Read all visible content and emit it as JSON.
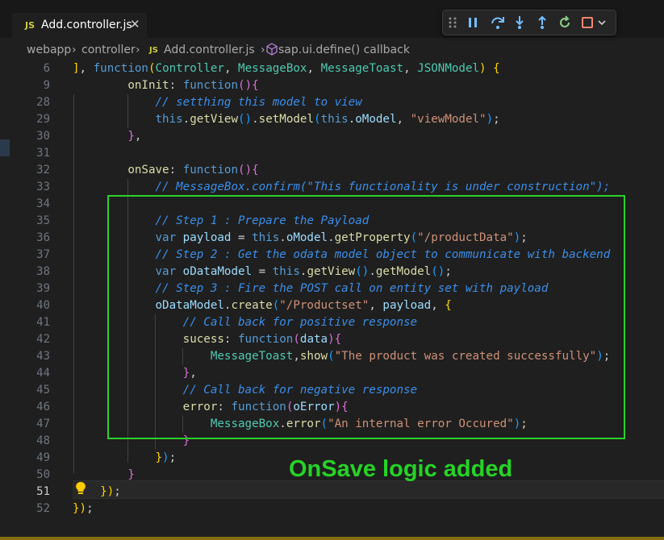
{
  "tab": {
    "badge": "JS",
    "title": "Add.controller.js",
    "close_glyph": "✕"
  },
  "breadcrumb": [
    "webapp",
    "controller",
    "Add.controller.js",
    "sap.ui.define() callback"
  ],
  "breadcrumb_js_badge": "JS",
  "debug_toolbar": [
    "drag-handle-icon",
    "pause-icon",
    "step-over-icon",
    "step-into-icon",
    "step-out-icon",
    "restart-icon",
    "stop-icon",
    "chevron-down-icon"
  ],
  "lines": [
    {
      "n": "6",
      "html": "<span class=\"b1\">]</span>, <span class=\"kw\">function</span><span class=\"b1\">(</span><span class=\"cls\">Controller</span>, <span class=\"cls\">MessageBox</span>, <span class=\"cls\">MessageToast</span>, <span class=\"cls\">JSONModel</span><span class=\"b1\">)</span> <span class=\"b1\">{</span>"
    },
    {
      "n": "9",
      "html": "        <span class=\"fn\">onInit</span>: <span class=\"kw\">function</span><span class=\"b2\">()</span><span class=\"b2\">{</span>"
    },
    {
      "n": "28",
      "html": "            <span class=\"cm\">// setthing this model to view</span>"
    },
    {
      "n": "29",
      "html": "            <span class=\"kw\">this</span>.<span class=\"fn\">getView</span><span class=\"b3\">()</span>.<span class=\"fn\">setModel</span><span class=\"b3\">(</span><span class=\"kw\">this</span>.<span class=\"prop\">oModel</span>, <span class=\"str\">\"viewModel\"</span><span class=\"b3\">)</span>;"
    },
    {
      "n": "30",
      "html": "        <span class=\"b2\">}</span>,"
    },
    {
      "n": "31",
      "html": ""
    },
    {
      "n": "32",
      "html": "        <span class=\"fn\">onSave</span>: <span class=\"kw\">function</span><span class=\"b2\">()</span><span class=\"b2\">{</span>"
    },
    {
      "n": "33",
      "html": "            <span class=\"cm\">// MessageBox.confirm(\"This functionality is under construction\");</span>"
    },
    {
      "n": "34",
      "html": ""
    },
    {
      "n": "35",
      "html": "            <span class=\"cm\">// Step 1 : Prepare the Payload</span>"
    },
    {
      "n": "36",
      "html": "            <span class=\"kw\">var</span> <span class=\"var\">payload</span> = <span class=\"kw\">this</span>.<span class=\"prop\">oModel</span>.<span class=\"fn\">getProperty</span><span class=\"b3\">(</span><span class=\"str\">\"/productData\"</span><span class=\"b3\">)</span>;"
    },
    {
      "n": "37",
      "html": "            <span class=\"cm\">// Step 2 : Get the odata model object to communicate with backend</span>"
    },
    {
      "n": "38",
      "html": "            <span class=\"kw\">var</span> <span class=\"var\">oDataModel</span> = <span class=\"kw\">this</span>.<span class=\"fn\">getView</span><span class=\"b3\">()</span>.<span class=\"fn\">getModel</span><span class=\"b3\">()</span>;"
    },
    {
      "n": "39",
      "html": "            <span class=\"cm\">// Step 3 : Fire the POST call on entity set with payload</span>"
    },
    {
      "n": "40",
      "html": "            <span class=\"var\">oDataModel</span>.<span class=\"fn\">create</span><span class=\"b3\">(</span><span class=\"str\">\"/Productset\"</span>, <span class=\"var\">payload</span>, <span class=\"b1\">{</span>"
    },
    {
      "n": "41",
      "html": "                <span class=\"cm\">// Call back for positive response</span>"
    },
    {
      "n": "42",
      "html": "                <span class=\"fn\">sucess</span>: <span class=\"kw\">function</span><span class=\"b2\">(</span><span class=\"var\">data</span><span class=\"b2\">)</span><span class=\"b2\">{</span>"
    },
    {
      "n": "43",
      "html": "                    <span class=\"cls\">MessageToast</span>,<span class=\"fn\">show</span><span class=\"b3\">(</span><span class=\"str\">\"The product was created successfully\"</span><span class=\"b3\">)</span>;"
    },
    {
      "n": "44",
      "html": "                <span class=\"b2\">}</span>,"
    },
    {
      "n": "45",
      "html": "                <span class=\"cm\">// Call back for negative response</span>"
    },
    {
      "n": "46",
      "html": "                <span class=\"fn\">error</span>: <span class=\"kw\">function</span><span class=\"b2\">(</span><span class=\"var\">oError</span><span class=\"b2\">)</span><span class=\"b2\">{</span>"
    },
    {
      "n": "47",
      "html": "                    <span class=\"cls\">MessageBox</span>.<span class=\"fn\">error</span><span class=\"b3\">(</span><span class=\"str\">\"An internal error Occured\"</span><span class=\"b3\">)</span>;"
    },
    {
      "n": "48",
      "html": "                <span class=\"b2\">}</span>"
    },
    {
      "n": "49",
      "html": "            <span class=\"b1\">}</span><span class=\"b3\">)</span>;"
    },
    {
      "n": "50",
      "html": "        <span class=\"b2\">}</span>"
    },
    {
      "n": "51",
      "html": "    <span class=\"b1\">}</span><span class=\"b1\">)</span>;"
    },
    {
      "n": "52",
      "html": "<span class=\"b1\">}</span><span class=\"b1\">)</span>;"
    }
  ],
  "current_line": "51",
  "annotation": {
    "label": "OnSave logic added",
    "color": "#2bd02b"
  }
}
